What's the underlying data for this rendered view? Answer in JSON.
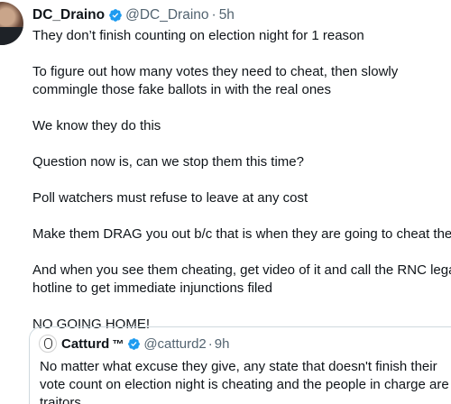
{
  "tweet": {
    "display_name": "DC_Draino",
    "handle": "@DC_Draino",
    "separator": "·",
    "time": "5h",
    "paragraphs": [
      "They don’t finish counting on election night for 1 reason",
      "To figure out how many votes they need to cheat, then slowly commingle those fake ballots in with the real ones",
      "We know they do this",
      "Question now is, can we stop them this time?",
      "Poll watchers must refuse to leave at any cost",
      "Make them DRAG you out b/c that is when they are going to cheat the most",
      "And when you see them cheating, get video of it and call the RNC legal hotline to get immediate injunctions filed",
      "NO GOING HOME!"
    ]
  },
  "quote": {
    "display_name": "Catturd",
    "tm": "™",
    "handle": "@catturd2",
    "separator": "·",
    "time": "9h",
    "text": "No matter what excuse they give, any state that doesn't finish their vote count on election night is cheating and the people in charge are traitors."
  },
  "colors": {
    "verified_blue": "#1d9bf0",
    "text": "#0f1419",
    "secondary_text": "#536471",
    "border": "#cfd9de"
  },
  "icons": {
    "verified": "verified-badge-icon",
    "avatar": "user-avatar",
    "quote_avatar": "catturd-avatar"
  }
}
